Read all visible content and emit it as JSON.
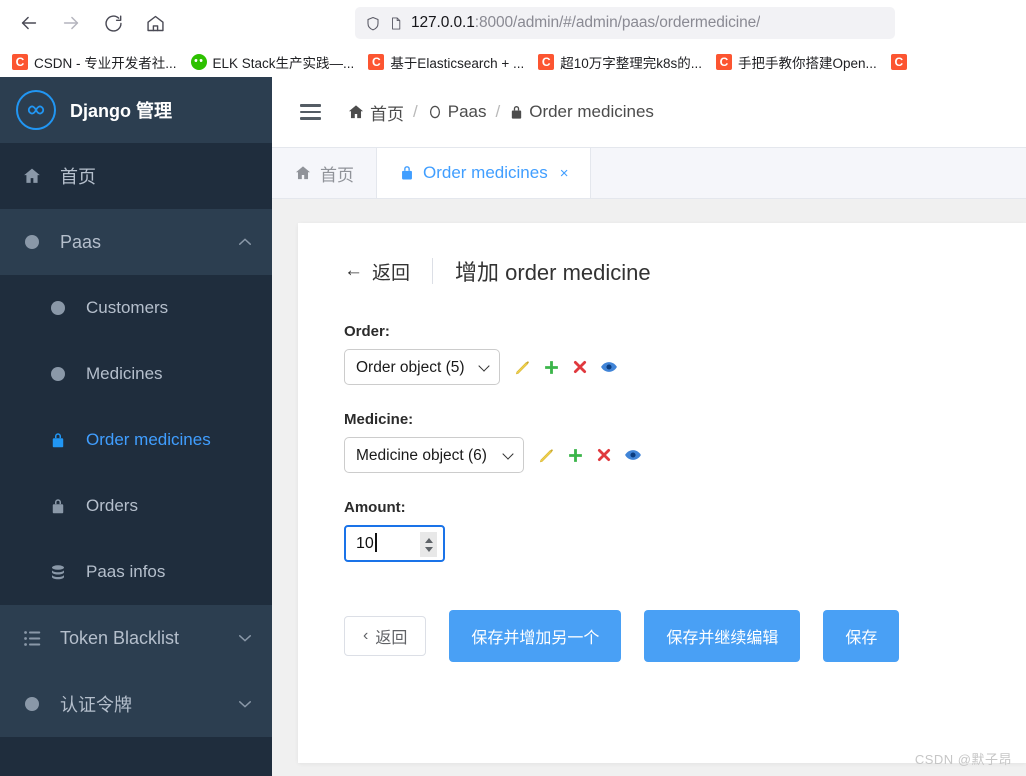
{
  "browser": {
    "nav": {
      "back": "back-arrow",
      "forward": "forward-arrow",
      "reload": "reload",
      "home": "home"
    },
    "url": {
      "host": "127.0.0.1",
      "rest": ":8000/admin/#/admin/paas/ordermedicine/",
      "full": "127.0.0.1:8000/admin/#/admin/paas/ordermedicine/"
    },
    "bookmarks": [
      {
        "label": "CSDN - 专业开发者社...",
        "icon": "csdn-icon",
        "type": "csdn"
      },
      {
        "label": "ELK Stack生产实践—...",
        "icon": "wechat-icon",
        "type": "wechat"
      },
      {
        "label": "基于Elasticsearch + ...",
        "icon": "csdn-icon",
        "type": "csdn"
      },
      {
        "label": "超10万字整理完k8s的...",
        "icon": "csdn-icon",
        "type": "csdn"
      },
      {
        "label": "手把手教你搭建Open...",
        "icon": "csdn-icon",
        "type": "csdn"
      },
      {
        "label": "",
        "icon": "csdn-icon",
        "type": "csdn"
      }
    ]
  },
  "sidebar": {
    "brand": "Django 管理",
    "brand_logo": "infinity-icon",
    "items": [
      {
        "label": "首页",
        "icon": "home-icon",
        "level": "top",
        "style": "dark",
        "chevron": "",
        "active": false
      },
      {
        "label": "Paas",
        "icon": "dot-icon",
        "level": "group",
        "style": "group",
        "chevron": "up",
        "active": false
      },
      {
        "label": "Customers",
        "icon": "dot-icon",
        "level": "sub",
        "style": "dark",
        "chevron": "",
        "active": false
      },
      {
        "label": "Medicines",
        "icon": "dot-icon",
        "level": "sub",
        "style": "dark",
        "chevron": "",
        "active": false
      },
      {
        "label": "Order medicines",
        "icon": "lock-icon",
        "level": "sub",
        "style": "dark",
        "chevron": "",
        "active": true
      },
      {
        "label": "Orders",
        "icon": "lock-icon",
        "level": "sub",
        "style": "dark",
        "chevron": "",
        "active": false
      },
      {
        "label": "Paas infos",
        "icon": "database-icon",
        "level": "sub",
        "style": "dark",
        "chevron": "",
        "active": false
      },
      {
        "label": "Token Blacklist",
        "icon": "list-icon",
        "level": "group",
        "style": "group",
        "chevron": "down",
        "active": false
      },
      {
        "label": "认证令牌",
        "icon": "dot-icon",
        "level": "group",
        "style": "group",
        "chevron": "down",
        "active": false
      }
    ]
  },
  "topbar": {
    "menu_toggle": "hamburger-icon",
    "breadcrumb": [
      {
        "label": "首页",
        "icon": "home-icon"
      },
      {
        "label": "Paas",
        "icon": "circle-icon"
      },
      {
        "label": "Order medicines",
        "icon": "lock-icon"
      }
    ],
    "separator": "/"
  },
  "tabs": [
    {
      "label": "首页",
      "icon": "home-icon",
      "active": false,
      "closable": false
    },
    {
      "label": "Order medicines",
      "icon": "lock-icon",
      "active": true,
      "closable": true,
      "close": "×"
    }
  ],
  "form": {
    "back_label": "返回",
    "back_arrow": "←",
    "title": "增加 order medicine",
    "fields": [
      {
        "label": "Order:",
        "type": "select",
        "value": "Order object (5)",
        "actions": [
          "edit-pencil-icon",
          "add-plus-icon",
          "delete-cross-icon",
          "view-eye-icon"
        ]
      },
      {
        "label": "Medicine:",
        "type": "select",
        "value": "Medicine object (6)",
        "actions": [
          "edit-pencil-icon",
          "add-plus-icon",
          "delete-cross-icon",
          "view-eye-icon"
        ]
      },
      {
        "label": "Amount:",
        "type": "number",
        "value": "10"
      }
    ],
    "buttons": [
      {
        "label": "返回",
        "kind": "back",
        "chevron": "‹"
      },
      {
        "label": "保存并增加另一个",
        "kind": "primary"
      },
      {
        "label": "保存并继续编辑",
        "kind": "primary"
      },
      {
        "label": "保存",
        "kind": "primary"
      }
    ]
  },
  "watermark": "CSDN @默子昂",
  "colors": {
    "sidebar_dark": "#1f2d3d",
    "sidebar_group": "#2c3e50",
    "accent_blue": "#409eff",
    "button_blue": "#49a0f5",
    "focus_blue": "#1a73e8",
    "csdn_orange": "#fc5531",
    "wechat_green": "#2dc100"
  }
}
